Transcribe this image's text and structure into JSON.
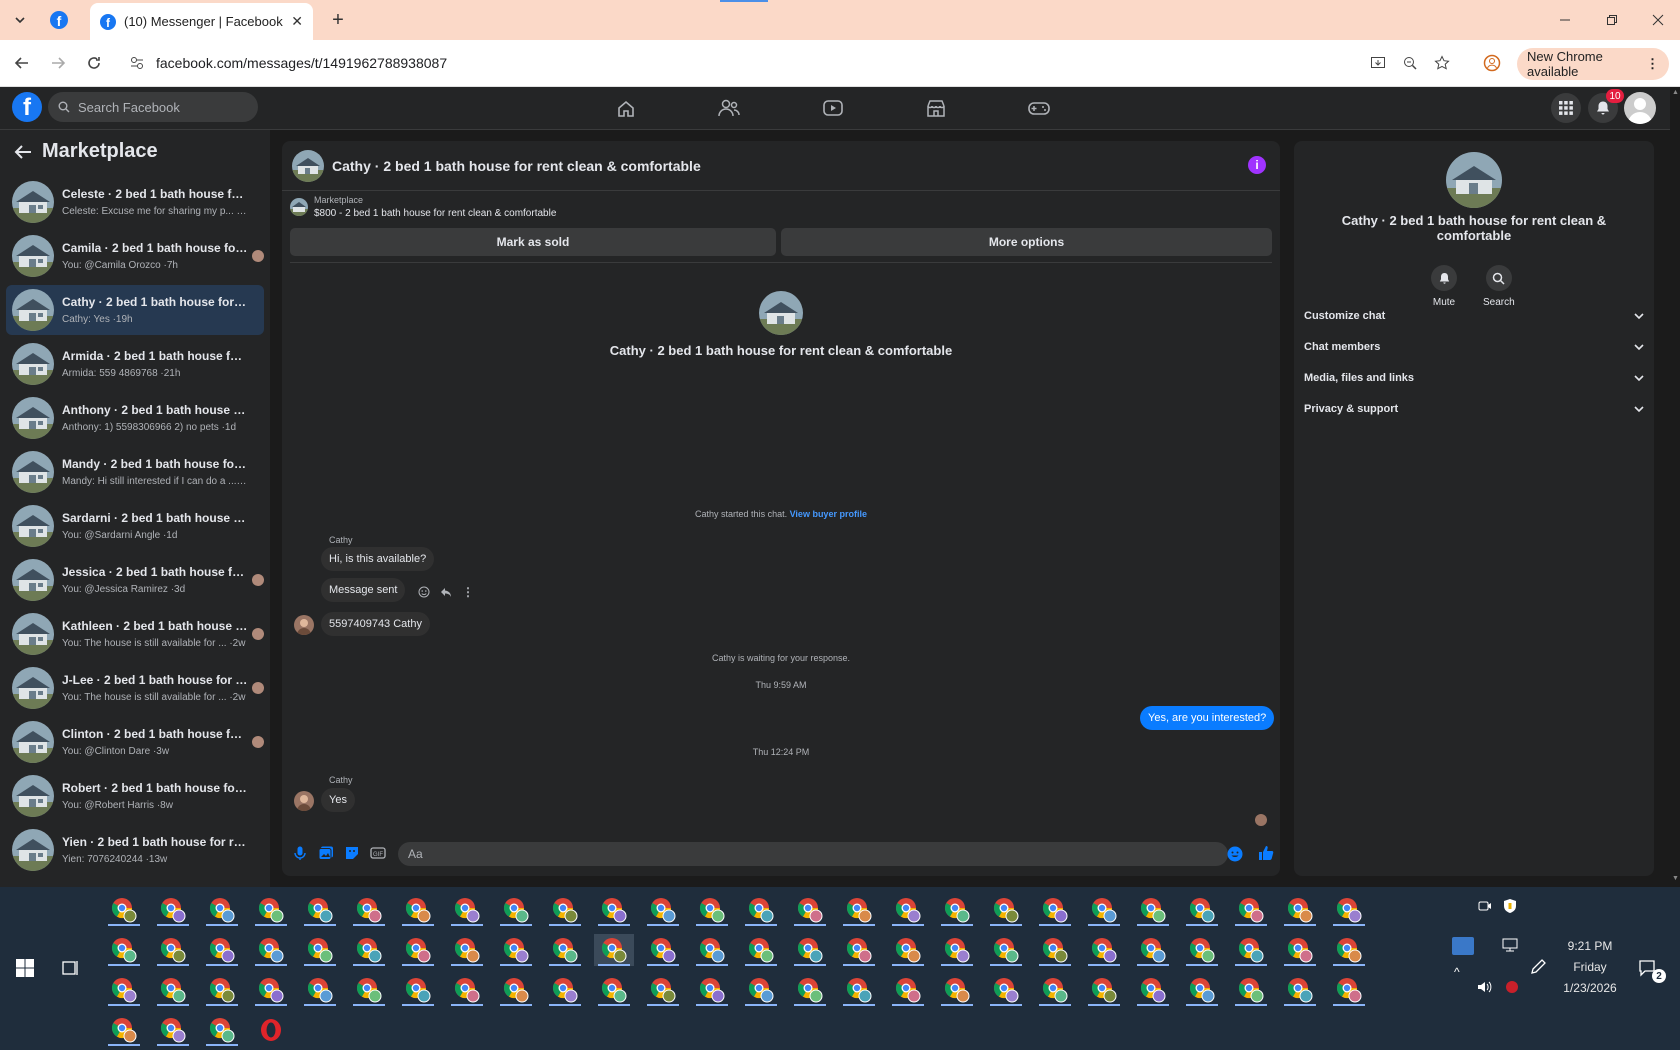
{
  "browser": {
    "tab_title": "(10) Messenger | Facebook",
    "url": "facebook.com/messages/t/1491962788938087",
    "new_chrome_label": "New Chrome available"
  },
  "fb": {
    "search_placeholder": "Search Facebook",
    "notif_count": "10"
  },
  "sidebar": {
    "title": "Marketplace",
    "conversations": [
      {
        "name": "Celeste · 2 bed 1 bath house for re...",
        "preview": "Celeste: Excuse me for sharing my p... ·18m",
        "active": false,
        "seen": false
      },
      {
        "name": "Camila · 2 bed 1 bath house for ...",
        "preview": "You: @Camila Orozco ·7h",
        "active": false,
        "seen": true
      },
      {
        "name": "Cathy · 2 bed 1 bath house for rent...",
        "preview": "Cathy: Yes ·19h",
        "active": true,
        "seen": false
      },
      {
        "name": "Armida · 2 bed 1 bath house for re...",
        "preview": "Armida: 559 4869768 ·21h",
        "active": false,
        "seen": false
      },
      {
        "name": "Anthony · 2 bed 1 bath house for r...",
        "preview": "Anthony: 1) 5598306966 2) no pets ·1d",
        "active": false,
        "seen": false
      },
      {
        "name": "Mandy · 2 bed 1 bath house for re...",
        "preview": "Mandy: Hi still interested if I can do a ... ·1d",
        "active": false,
        "seen": false
      },
      {
        "name": "Sardarni · 2 bed 1 bath house for r...",
        "preview": "You: @Sardarni Angle ·1d",
        "active": false,
        "seen": false
      },
      {
        "name": "Jessica · 2 bed 1 bath house for r...",
        "preview": "You: @Jessica Ramirez ·3d",
        "active": false,
        "seen": true
      },
      {
        "name": "Kathleen · 2 bed 1 bath house fo...",
        "preview": "You: The house is still available for ... ·2w",
        "active": false,
        "seen": true
      },
      {
        "name": "J-Lee · 2 bed 1 bath house for re...",
        "preview": "You: The house is still available for ... ·2w",
        "active": false,
        "seen": true
      },
      {
        "name": "Clinton · 2 bed 1 bath house for ...",
        "preview": "You: @Clinton Dare ·3w",
        "active": false,
        "seen": true
      },
      {
        "name": "Robert · 2 bed 1 bath house for re...",
        "preview": "You: @Robert Harris ·8w",
        "active": false,
        "seen": false
      },
      {
        "name": "Yien · 2 bed 1 bath house for rent ...",
        "preview": "Yien: 7076240244 ·13w",
        "active": false,
        "seen": false
      }
    ]
  },
  "chat": {
    "title": "Cathy · 2 bed 1 bath house for rent clean & comfortable",
    "marketplace_label": "Marketplace",
    "listing": "$800 - 2 bed 1 bath house for rent clean & comfortable",
    "mark_sold": "Mark as sold",
    "more_options": "More options",
    "started": "Cathy started this chat.",
    "view_profile": "View buyer profile",
    "sender": "Cathy",
    "msg1": "Hi, is this available?",
    "msg2": "Message sent",
    "msg3": "5597409743 Cathy",
    "waiting": "Cathy is waiting for your response.",
    "time1": "Thu 9:59 AM",
    "out_msg": "Yes, are you interested?",
    "time2": "Thu 12:24 PM",
    "sender2": "Cathy",
    "msg4": "Yes",
    "input_placeholder": "Aa"
  },
  "details": {
    "title": "Cathy · 2 bed 1 bath house for rent clean & comfortable",
    "mute": "Mute",
    "search": "Search",
    "sections": [
      "Customize chat",
      "Chat members",
      "Media, files and links",
      "Privacy & support"
    ]
  },
  "taskbar": {
    "time": "9:21 PM",
    "day": "Friday",
    "date": "1/23/2026",
    "notif": "2"
  }
}
